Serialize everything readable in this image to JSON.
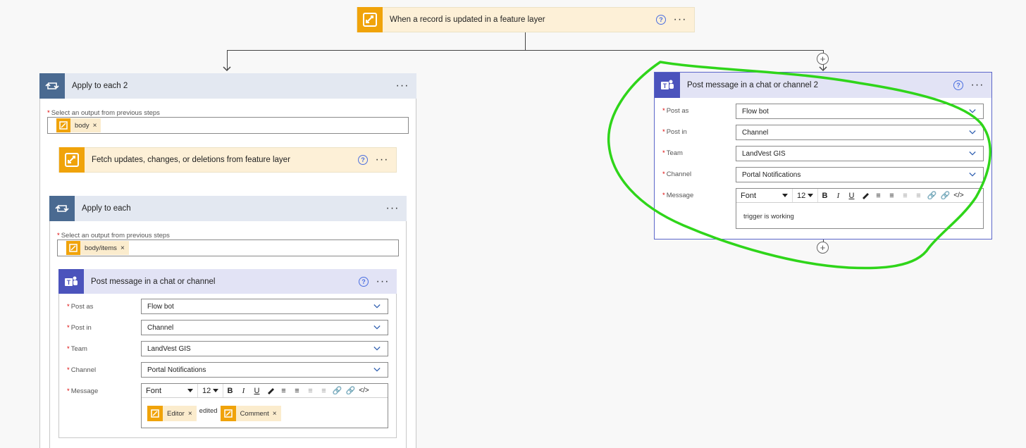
{
  "trigger": {
    "title": "When a record is updated in a feature layer",
    "help": "?",
    "more": "···"
  },
  "apply_each_2": {
    "title": "Apply to each 2",
    "more": "···",
    "select_label": "Select an output from previous steps",
    "token": "body"
  },
  "fetch": {
    "title": "Fetch updates, changes, or deletions from feature layer",
    "help": "?",
    "more": "···"
  },
  "apply_each": {
    "title": "Apply to each",
    "more": "···",
    "select_label": "Select an output from previous steps",
    "token": "body/items"
  },
  "post1": {
    "title": "Post message in a chat or channel",
    "help": "?",
    "more": "···",
    "post_as_label": "Post as",
    "post_as": "Flow bot",
    "post_in_label": "Post in",
    "post_in": "Channel",
    "team_label": "Team",
    "team": "LandVest GIS",
    "channel_label": "Channel",
    "channel": "Portal Notifications",
    "message_label": "Message",
    "font": "Font",
    "size": "12",
    "token_editor": "Editor",
    "edited_text": "edited",
    "token_comment": "Comment"
  },
  "post2": {
    "title": "Post message in a chat or channel 2",
    "help": "?",
    "more": "···",
    "post_as_label": "Post as",
    "post_as": "Flow bot",
    "post_in_label": "Post in",
    "post_in": "Channel",
    "team_label": "Team",
    "team": "LandVest GIS",
    "channel_label": "Channel",
    "channel": "Portal Notifications",
    "message_label": "Message",
    "font": "Font",
    "size": "12",
    "message_text": "trigger is working"
  },
  "colors": {
    "accent": "#4a6ee0",
    "highlight": "#2fd51a",
    "orange": "#f0a30a",
    "teams": "#4b53bc",
    "slate": "#4a6a91"
  }
}
